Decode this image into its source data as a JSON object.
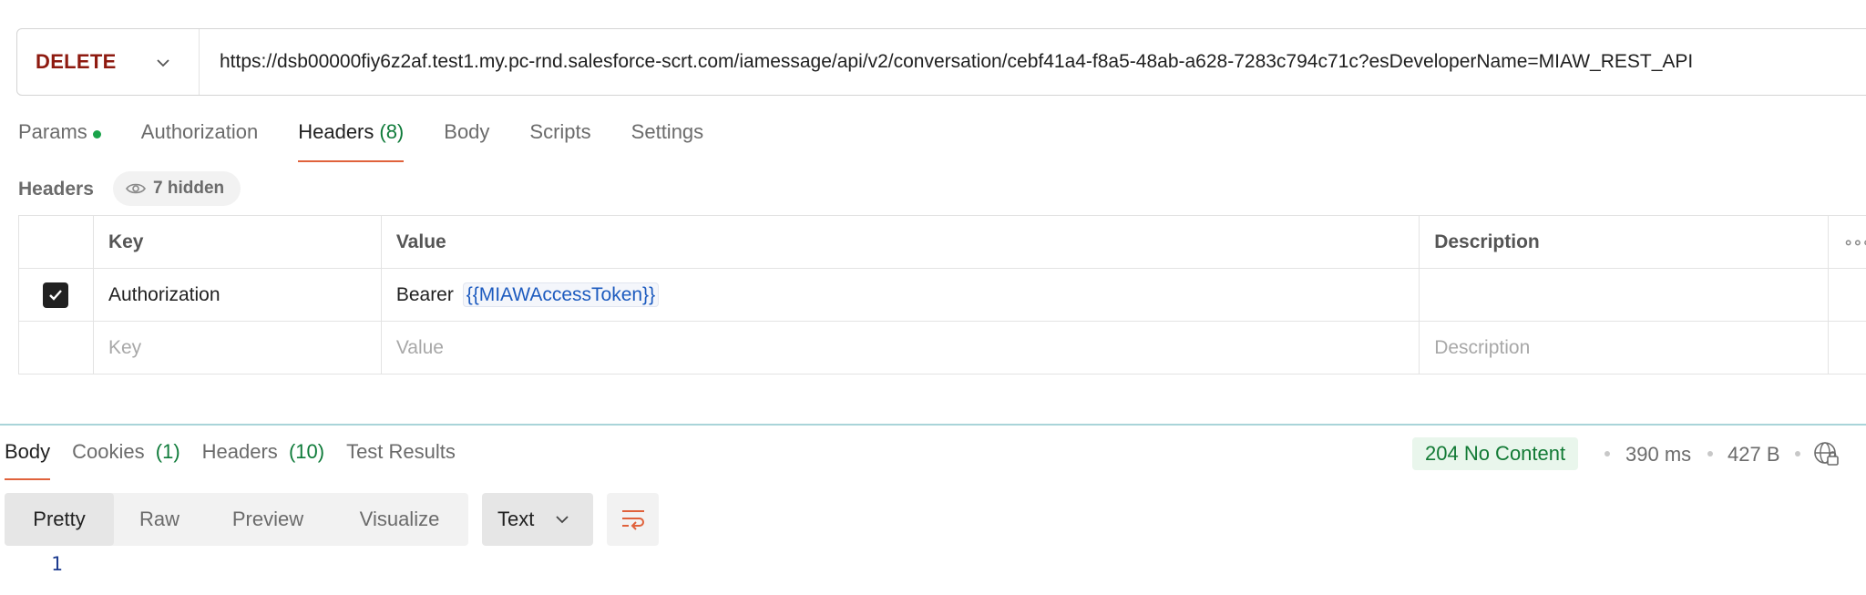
{
  "request": {
    "method": "DELETE",
    "url": "https://dsb00000fiy6z2af.test1.my.pc-rnd.salesforce-scrt.com/iamessage/api/v2/conversation/cebf41a4-f8a5-48ab-a628-7283c794c71c?esDeveloperName=MIAW_REST_API"
  },
  "request_tabs": {
    "params": "Params",
    "authorization": "Authorization",
    "headers": "Headers",
    "headers_count": "(8)",
    "body": "Body",
    "scripts": "Scripts",
    "settings": "Settings"
  },
  "headers_section": {
    "label": "Headers",
    "hidden": "7 hidden"
  },
  "headers_table": {
    "columns": {
      "key": "Key",
      "value": "Value",
      "description": "Description"
    },
    "row": {
      "key": "Authorization",
      "value_prefix": "Bearer",
      "value_var": "{{MIAWAccessToken}}",
      "checked": true
    },
    "placeholder": {
      "key": "Key",
      "value": "Value",
      "description": "Description"
    }
  },
  "response_tabs": {
    "body": "Body",
    "cookies": "Cookies",
    "cookies_count": "(1)",
    "headers": "Headers",
    "headers_count": "(10)",
    "test_results": "Test Results"
  },
  "response_status": {
    "status": "204 No Content",
    "time": "390 ms",
    "size": "427 B"
  },
  "format_toolbar": {
    "pretty": "Pretty",
    "raw": "Raw",
    "preview": "Preview",
    "visualize": "Visualize",
    "type": "Text"
  },
  "editor": {
    "line_number": "1"
  },
  "colors": {
    "method": "#8e1a10",
    "accent": "#e0623c",
    "count_green": "#0f7b3a",
    "status_bg": "#e9f6ec",
    "variable": "#1d5bbf"
  }
}
